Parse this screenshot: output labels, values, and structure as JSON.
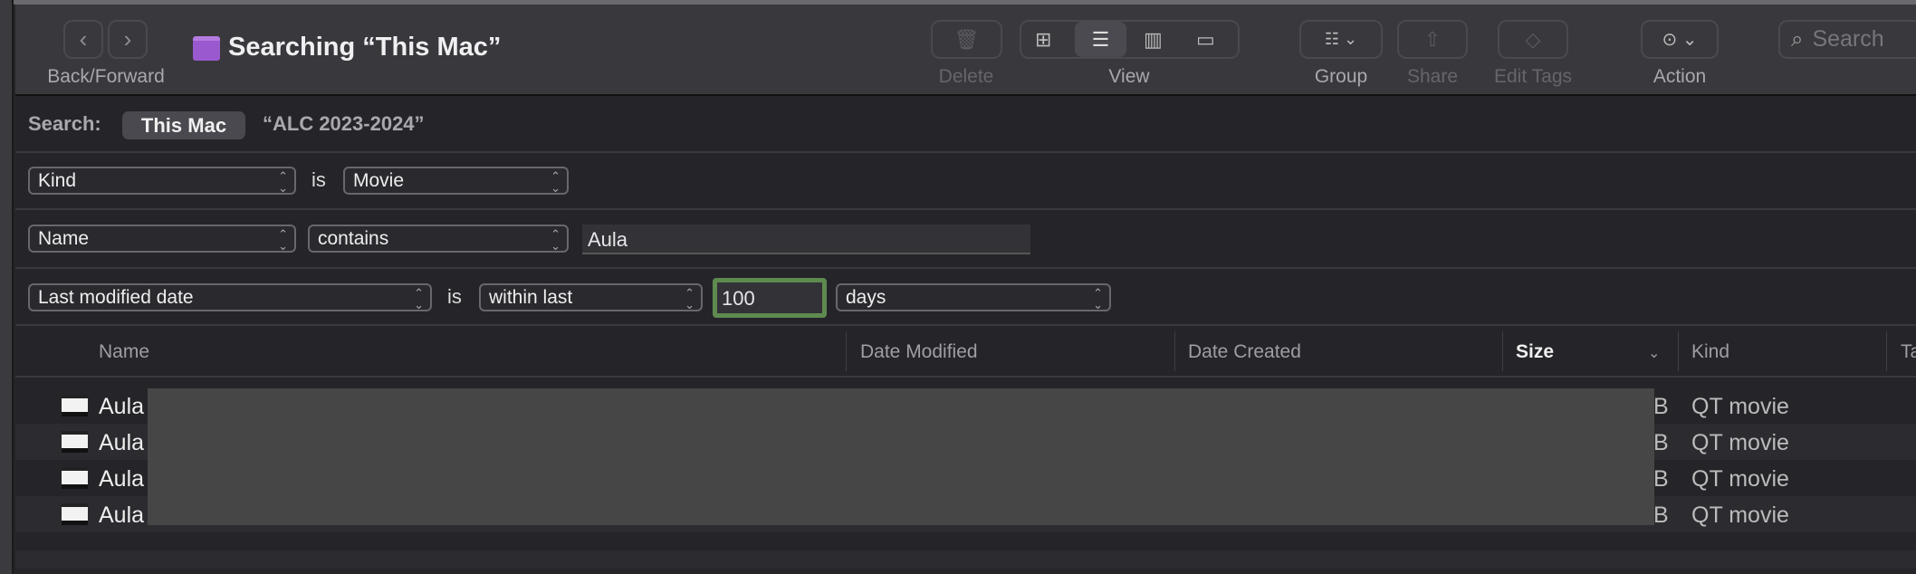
{
  "toolbar": {
    "title": "Searching “This Mac”",
    "back_forward": "Back/Forward",
    "delete": "Delete",
    "view": "View",
    "group": "Group",
    "share": "Share",
    "edit_tags": "Edit Tags",
    "action": "Action",
    "search_placeholder": "Search"
  },
  "search_scope": {
    "label": "Search:",
    "this_mac": "This Mac",
    "folder": "“ALC 2023-2024”"
  },
  "criteria": [
    {
      "attribute": "Kind",
      "operator": "is",
      "value": "Movie"
    },
    {
      "attribute": "Name",
      "operator": "contains",
      "value": "Aula"
    },
    {
      "attribute": "Last modified date",
      "is": "is",
      "operator": "within last",
      "value": "100",
      "unit": "days"
    }
  ],
  "columns": {
    "name": "Name",
    "date_modified": "Date Modified",
    "date_created": "Date Created",
    "size": "Size",
    "kind": "Kind",
    "tags": "Ta"
  },
  "files": [
    {
      "name": "Aula",
      "size": "B",
      "kind": "QT movie"
    },
    {
      "name": "Aula",
      "size": "B",
      "kind": "QT movie"
    },
    {
      "name": "Aula",
      "size": "B",
      "kind": "QT movie"
    },
    {
      "name": "Aula",
      "size": "B",
      "kind": "QT movie"
    }
  ],
  "colors": {
    "highlight": "#5f8a4f",
    "folder": "#9b59d0"
  }
}
